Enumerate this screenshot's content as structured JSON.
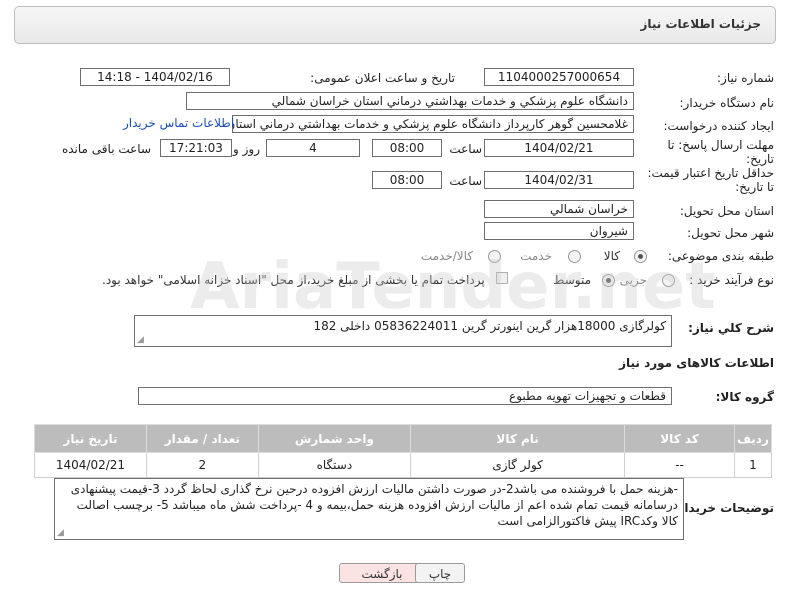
{
  "header": {
    "title": "جزئیات اطلاعات نیاز"
  },
  "fields": {
    "need_number": {
      "label": "شماره نیاز:",
      "value": "1104000257000654"
    },
    "announce_datetime": {
      "label": "تاریخ و ساعت اعلان عمومی:",
      "value": "1404/02/16 - 14:18"
    },
    "buyer_org": {
      "label": "نام دستگاه خریدار:",
      "value": "دانشگاه علوم پزشکي و خدمات بهداشتي درماني استان خراسان شمالي"
    },
    "requester": {
      "label": "ایجاد کننده درخواست:",
      "value": "غلامحسین گوهر کارپرداز  دانشگاه علوم پزشکي و خدمات بهداشتي درماني استان خراسان شمالي",
      "link": "اطلاعات تماس خریدار"
    },
    "reply_deadline": {
      "label_line1": "مهلت ارسال پاسخ: تا",
      "label_line2": "تاریخ:",
      "date": "1404/02/21",
      "time_label": "ساعت",
      "time": "08:00",
      "days": "4",
      "days_label": "روز و",
      "remaining": "17:21:03",
      "remaining_label": "ساعت باقی مانده"
    },
    "price_validity": {
      "label_line1": "حداقل تاریخ اعتبار قیمت:",
      "label_line2": "تا تاریخ:",
      "date": "1404/02/31",
      "time_label": "ساعت",
      "time": "08:00"
    },
    "delivery_province": {
      "label": "استان محل تحویل:",
      "value": "خراسان شمالي"
    },
    "delivery_city": {
      "label": "شهر محل تحویل:",
      "value": "شیروان"
    },
    "category": {
      "label": "طبقه بندی موضوعی:",
      "options": [
        "کالا",
        "خدمت",
        "کالا/خدمت"
      ],
      "selected": "کالا"
    },
    "purchase_type": {
      "label": "نوع فرآیند خرید :",
      "options": [
        "جزیی",
        "متوسط"
      ],
      "selected": "متوسط",
      "treasury_note": "پرداخت تمام یا بخشی از مبلغ خرید،از محل \"اسناد خزانه اسلامی\" خواهد بود."
    }
  },
  "general_description": {
    "label": "شرح کلي نیاز:",
    "value": "کولرگازی 18000هزار گرین اینورتر گرین 05836224011 داخلی 182"
  },
  "items_section": {
    "title": "اطلاعات کالاهای مورد نیاز",
    "group_label": "گروه کالا:",
    "group_value": "قطعات و تجهیزات تهویه مطبوع",
    "columns": [
      "ردیف",
      "کد کالا",
      "نام کالا",
      "واحد شمارش",
      "تعداد / مقدار",
      "تاریخ نیاز"
    ],
    "rows": [
      {
        "index": "1",
        "code": "--",
        "name": "کولر گازی",
        "unit": "دستگاه",
        "qty": "2",
        "date": "1404/02/21"
      }
    ]
  },
  "buyer_notes": {
    "label": "توضیحات خریدار:",
    "value": "-هزینه حمل با فروشنده می باشد2-در صورت داشتن مالیات ارزش افزوده درحین نرخ گذاری لحاظ گردد 3-قیمت پیشنهادی درسامانه  قیمت تمام شده اعم از مالیات ارزش افزوده هزینه حمل،بیمه و 4 -پرداخت شش ماه میباشد 5- برچسب اصالت کالا وکدIRC پیش فاکتورالزامی است"
  },
  "buttons": {
    "print": "چاپ",
    "back": "بازگشت"
  },
  "watermark": "AriaTender.net"
}
